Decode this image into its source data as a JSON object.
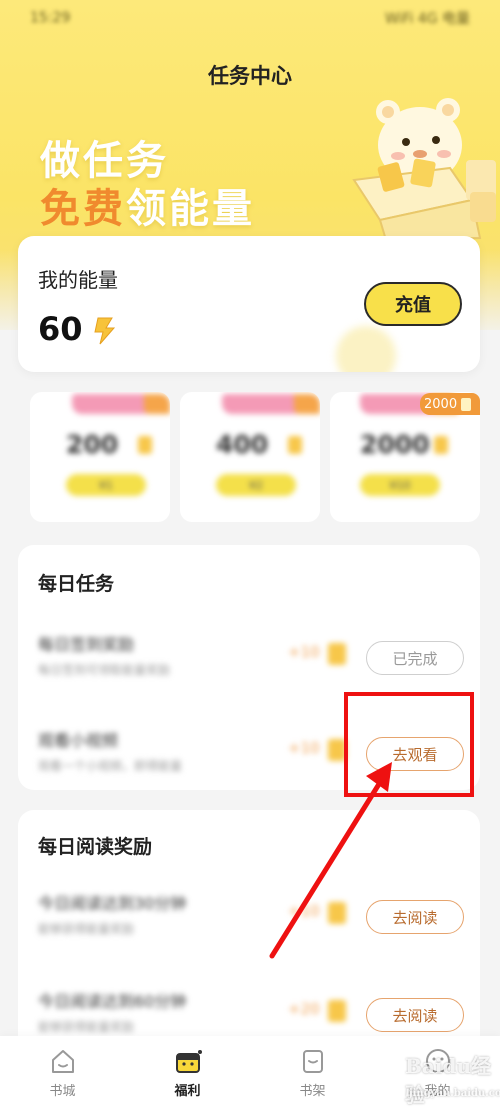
{
  "status_bar": {
    "time": "15:29",
    "indicators": "WiFi 4G 电量"
  },
  "page": {
    "title": "任务中心"
  },
  "banner": {
    "line1": "做任务",
    "line2_highlight": "免费",
    "line2_rest": "领能量"
  },
  "energy": {
    "label": "我的能量",
    "value": "60",
    "recharge_label": "充值"
  },
  "packages": [
    {
      "amount": "200",
      "buy_label": "¥1"
    },
    {
      "amount": "400",
      "buy_label": "¥2"
    },
    {
      "amount": "2000",
      "buy_label": "¥10"
    }
  ],
  "package_badge": "2000",
  "daily_tasks": {
    "title": "每日任务",
    "items": [
      {
        "title": "每日签到奖励",
        "desc": "每日签到可领取能量奖励",
        "reward": "+10",
        "action": "已完成",
        "state": "done"
      },
      {
        "title": "观看小视频",
        "desc": "观看一个小视频，即得能量",
        "reward": "+10",
        "action": "去观看",
        "state": "go"
      }
    ]
  },
  "reading_rewards": {
    "title": "每日阅读奖励",
    "items": [
      {
        "title": "今日阅读达到30分钟",
        "desc": "能够获得能量奖励",
        "reward": "+10",
        "action": "去阅读",
        "state": "go"
      },
      {
        "title": "今日阅读达到60分钟",
        "desc": "能够获得能量奖励",
        "reward": "+20",
        "action": "去阅读",
        "state": "go"
      }
    ]
  },
  "tabbar": [
    {
      "label": "书城",
      "icon": "home-icon",
      "active": false
    },
    {
      "label": "福利",
      "icon": "gift-pot-icon",
      "active": true
    },
    {
      "label": "书架",
      "icon": "bookshelf-icon",
      "active": false
    },
    {
      "label": "我的",
      "icon": "profile-icon",
      "active": false
    }
  ],
  "watermark": {
    "text": "Baidu经验",
    "site": "jingyan.baidu.com"
  },
  "colors": {
    "banner_yellow": "#fbe466",
    "accent_orange": "#f08a2e",
    "highlight_red": "#e11111",
    "button_yellow": "#f8e04a"
  }
}
